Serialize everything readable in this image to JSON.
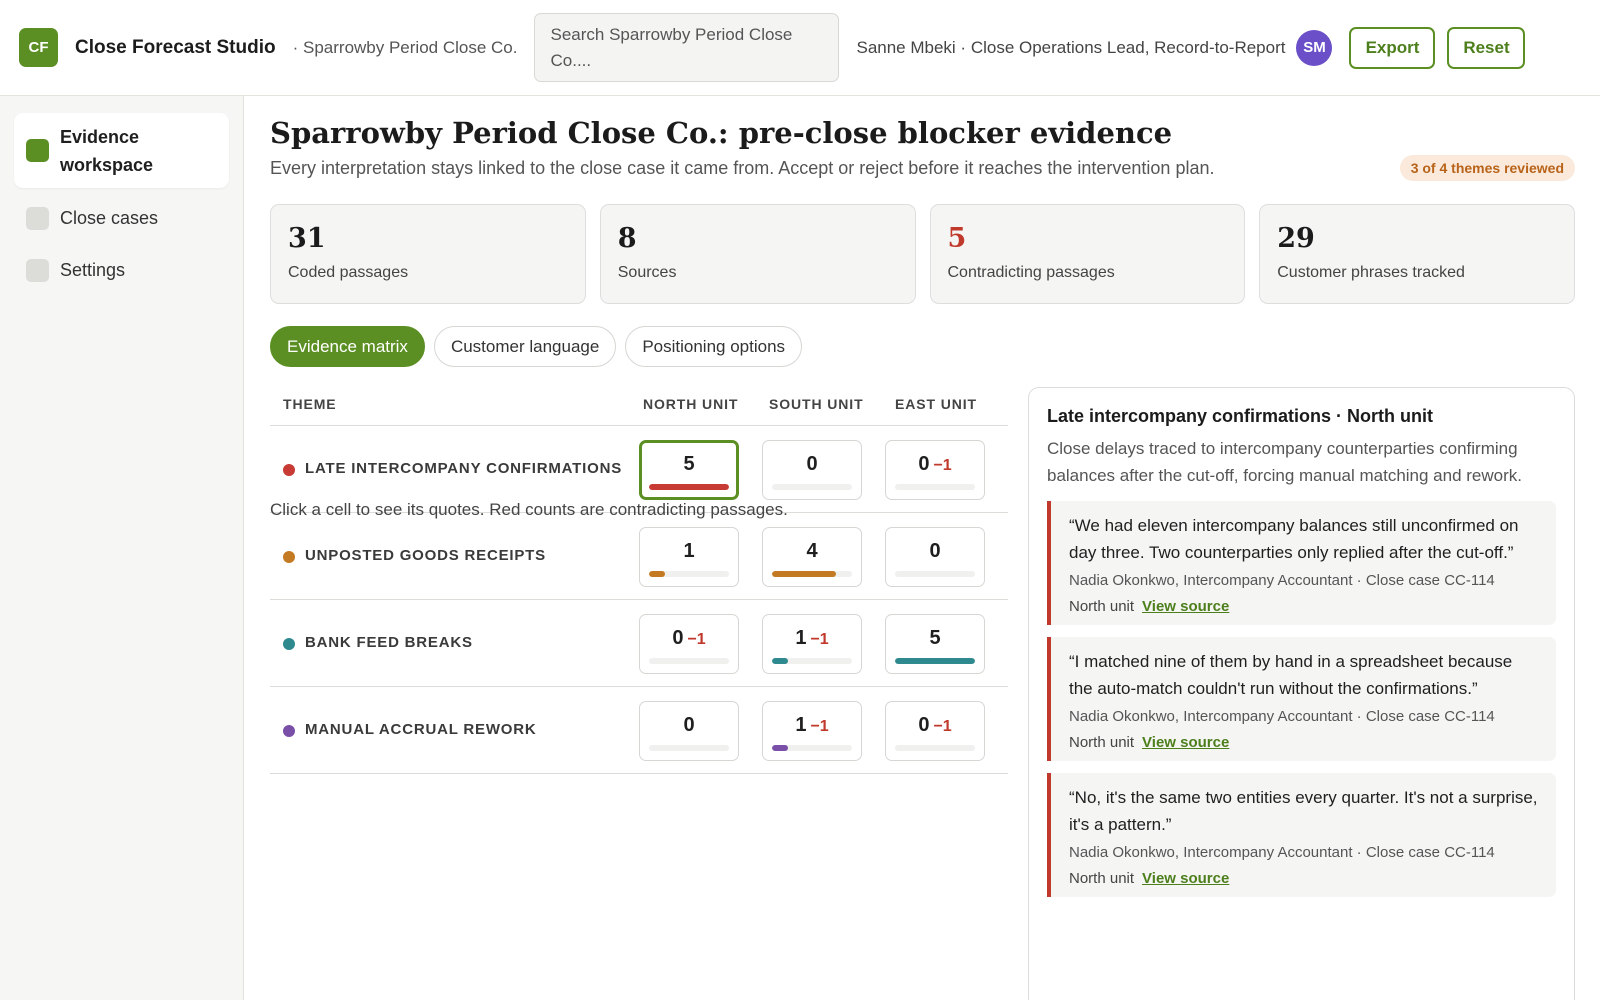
{
  "header": {
    "logo_text": "CF",
    "app_name": "Close Forecast Studio",
    "org": "· Sparrowby Period Close Co.",
    "search_placeholder": "Search Sparrowby Period Close Co....",
    "user": "Sanne Mbeki · Close Operations Lead, Record-to-Report",
    "avatar_initials": "SM",
    "export_label": "Export",
    "reset_label": "Reset"
  },
  "sidebar": {
    "items": [
      {
        "label": "Evidence workspace",
        "active": true
      },
      {
        "label": "Close cases",
        "active": false
      },
      {
        "label": "Settings",
        "active": false
      }
    ]
  },
  "page": {
    "title": "Sparrowby Period Close Co.: pre-close blocker evidence",
    "subtitle": "Every interpretation stays linked to the close case it came from. Accept or reject before it reaches the intervention plan.",
    "review_badge": "3 of 4 themes reviewed"
  },
  "stats": [
    {
      "value": "31",
      "label": "Coded passages",
      "alert": false
    },
    {
      "value": "8",
      "label": "Sources",
      "alert": false
    },
    {
      "value": "5",
      "label": "Contradicting passages",
      "alert": true
    },
    {
      "value": "29",
      "label": "Customer phrases tracked",
      "alert": false
    }
  ],
  "tabs": [
    {
      "label": "Evidence matrix",
      "active": true
    },
    {
      "label": "Customer language",
      "active": false
    },
    {
      "label": "Positioning options",
      "active": false
    }
  ],
  "matrix": {
    "columns": [
      "THEME",
      "NORTH UNIT",
      "SOUTH UNIT",
      "EAST UNIT"
    ],
    "max_count": 5,
    "rows": [
      {
        "theme": "Late intercompany confirmations",
        "color": "#c83a34",
        "cells": [
          {
            "count": "5",
            "contra": "",
            "selected": true
          },
          {
            "count": "0",
            "contra": ""
          },
          {
            "count": "0",
            "contra": "−1"
          }
        ]
      },
      {
        "theme": "Unposted goods receipts",
        "color": "#c47a23",
        "cells": [
          {
            "count": "1",
            "contra": ""
          },
          {
            "count": "4",
            "contra": ""
          },
          {
            "count": "0",
            "contra": ""
          }
        ]
      },
      {
        "theme": "Bank feed breaks",
        "color": "#2e8a8f",
        "cells": [
          {
            "count": "0",
            "contra": "−1"
          },
          {
            "count": "1",
            "contra": "−1"
          },
          {
            "count": "5",
            "contra": ""
          }
        ]
      },
      {
        "theme": "Manual accrual rework",
        "color": "#7a4fa8",
        "cells": [
          {
            "count": "0",
            "contra": ""
          },
          {
            "count": "1",
            "contra": "−1"
          },
          {
            "count": "0",
            "contra": "−1"
          }
        ]
      }
    ],
    "hint": "Click a cell to see its quotes. Red counts are contradicting passages."
  },
  "panel": {
    "title": "Late intercompany confirmations · North unit",
    "description": "Close delays traced to intercompany counterparties confirming balances after the cut-off, forcing manual matching and rework.",
    "quotes": [
      {
        "text": "“We had eleven intercompany balances still unconfirmed on day three. Two counterparties only replied after the cut-off.”",
        "meta": "Nadia Okonkwo, Intercompany Accountant · Close case CC-114",
        "unit": "North unit",
        "link": "View source"
      },
      {
        "text": "“I matched nine of them by hand in a spreadsheet because the auto-match couldn't run without the confirmations.”",
        "meta": "Nadia Okonkwo, Intercompany Accountant · Close case CC-114",
        "unit": "North unit",
        "link": "View source"
      },
      {
        "text": "“No, it's the same two entities every quarter. It's not a surprise, it's a pattern.”",
        "meta": "Nadia Okonkwo, Intercompany Accountant · Close case CC-114",
        "unit": "North unit",
        "link": "View source"
      }
    ]
  },
  "colors": {
    "brand": "#5b8f23",
    "alert": "#c0392b",
    "avatar": "#6a4fc9"
  }
}
